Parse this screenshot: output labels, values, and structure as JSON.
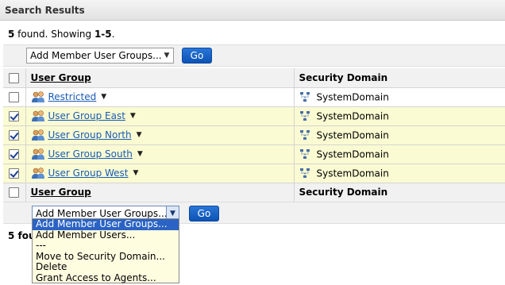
{
  "panel_title": "Search Results",
  "summary": {
    "count": "5",
    "found_text": " found. Showing ",
    "range": "1-5",
    "period": "."
  },
  "summary_bottom_partial": "5 fou",
  "top_bar": {
    "select_value": "Add Member User Groups...",
    "go_label": "Go"
  },
  "bottom_bar": {
    "select_value": "Add Member User Groups...",
    "go_label": "Go"
  },
  "columns": {
    "user_group": "User Group",
    "security_domain": "Security Domain"
  },
  "rows": [
    {
      "name": "Restricted",
      "domain": "SystemDomain",
      "checked": false
    },
    {
      "name": "User Group East",
      "domain": "SystemDomain",
      "checked": true
    },
    {
      "name": "User Group North",
      "domain": "SystemDomain",
      "checked": true
    },
    {
      "name": "User Group South",
      "domain": "SystemDomain",
      "checked": true
    },
    {
      "name": "User Group West",
      "domain": "SystemDomain",
      "checked": true
    }
  ],
  "dropdown_options": [
    "Add Member User Groups...",
    "Add Member Users...",
    "---",
    "Move to Security Domain...",
    "Delete",
    "Grant Access to Agents..."
  ],
  "dropdown_selected_index": 0,
  "colors": {
    "selected_row": "#fafbd2",
    "go_button": "#0b53b5",
    "link": "#1a5bb5",
    "highlight": "#2b63c4"
  }
}
